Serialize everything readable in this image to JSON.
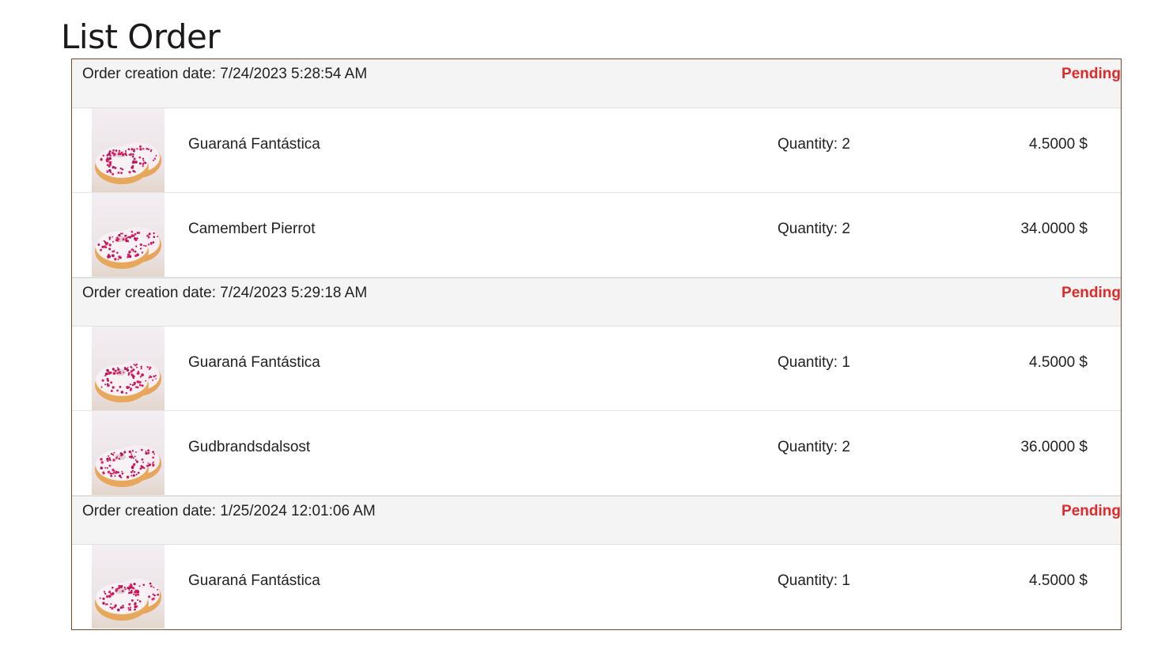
{
  "page": {
    "title": "List Order"
  },
  "colors": {
    "status_pending": "#e02a2a",
    "border": "#7a4b2a",
    "header_bg": "#f4f4f4"
  },
  "orders": [
    {
      "date_label": "Order creation date: 7/24/2023 5:28:54 AM",
      "status": "Pending",
      "items": [
        {
          "name": "Guaraná Fantástica",
          "quantity": "Quantity: 2",
          "price": "4.5000 $",
          "image": "donut-image"
        },
        {
          "name": "Camembert Pierrot",
          "quantity": "Quantity: 2",
          "price": "34.0000 $",
          "image": "donut-image"
        }
      ]
    },
    {
      "date_label": "Order creation date: 7/24/2023 5:29:18 AM",
      "status": "Pending",
      "items": [
        {
          "name": "Guaraná Fantástica",
          "quantity": "Quantity: 1",
          "price": "4.5000 $",
          "image": "donut-image"
        },
        {
          "name": "Gudbrandsdalsost",
          "quantity": "Quantity: 2",
          "price": "36.0000 $",
          "image": "donut-image"
        }
      ]
    },
    {
      "date_label": "Order creation date: 1/25/2024 12:01:06 AM",
      "status": "Pending",
      "items": [
        {
          "name": "Guaraná Fantástica",
          "quantity": "Quantity: 1",
          "price": "4.5000 $",
          "image": "donut-image"
        }
      ]
    }
  ]
}
